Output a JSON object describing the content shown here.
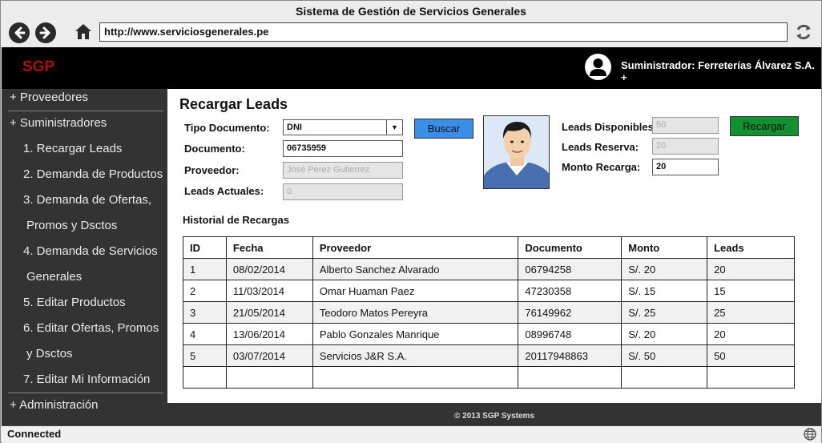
{
  "window": {
    "title": "Sistema de Gestión de Servicios Generales"
  },
  "browser": {
    "url": "http://www.serviciosgenerales.pe"
  },
  "header": {
    "brand": "SGP",
    "user": "Suministrador: Ferreterías Álvarez S.A. +"
  },
  "sidebar": {
    "items": [
      {
        "label": "+ Proveedores"
      },
      {
        "label": "+ Suministradores"
      },
      {
        "label": "1. Recargar Leads"
      },
      {
        "label": "2. Demanda de Productos"
      },
      {
        "label": "3. Demanda de Ofertas,"
      },
      {
        "label": "Promos y Dsctos"
      },
      {
        "label": "4. Demanda de Servicios"
      },
      {
        "label": "Generales"
      },
      {
        "label": "5. Editar Productos"
      },
      {
        "label": "6. Editar Ofertas, Promos"
      },
      {
        "label": "y Dsctos"
      },
      {
        "label": "7. Editar Mi Información"
      },
      {
        "label": "+ Administración"
      }
    ]
  },
  "main": {
    "title": "Recargar Leads",
    "form": {
      "tipo_documento_label": "Tipo Documento:",
      "tipo_documento_value": "DNI",
      "documento_label": "Documento:",
      "documento_value": "06735959",
      "proveedor_label": "Proveedor:",
      "proveedor_value": "José Perez Gutierrez",
      "leads_actuales_label": "Leads Actuales:",
      "leads_actuales_value": "0",
      "buscar_label": "Buscar",
      "leads_disponibles_label": "Leads Disponibles:",
      "leads_disponibles_value": "50",
      "leads_reserva_label": "Leads Reserva:",
      "leads_reserva_value": "20",
      "monto_recarga_label": "Monto Recarga:",
      "monto_recarga_value": "20",
      "recargar_label": "Recargar"
    },
    "history": {
      "title": "Historial de Recargas",
      "columns": [
        "ID",
        "Fecha",
        "Proveedor",
        "Documento",
        "Monto",
        "Leads"
      ],
      "rows": [
        [
          "1",
          "08/02/2014",
          "Alberto Sanchez Alvarado",
          "06794258",
          "S/. 20",
          "20"
        ],
        [
          "2",
          "11/03/2014",
          "Omar Huaman Paez",
          "47230358",
          "S/. 15",
          "15"
        ],
        [
          "3",
          "21/05/2014",
          "Teodoro Matos Pereyra",
          "76149962",
          "S/. 25",
          "25"
        ],
        [
          "4",
          "13/06/2014",
          "Pablo Gonzales Manrique",
          "08996748",
          "S/. 20",
          "20"
        ],
        [
          "5",
          "03/07/2014",
          "Servicios J&R S.A.",
          "20117948863",
          "S/. 50",
          "50"
        ],
        [
          "",
          "",
          "",
          "",
          "",
          ""
        ]
      ]
    }
  },
  "footer": {
    "copyright": "© 2013 SGP Systems"
  },
  "status": {
    "text": "Connected"
  },
  "colors": {
    "brand": "#b01010",
    "buscar": "#3a8ee8",
    "recargar": "#139032",
    "sidebar": "#333333"
  }
}
